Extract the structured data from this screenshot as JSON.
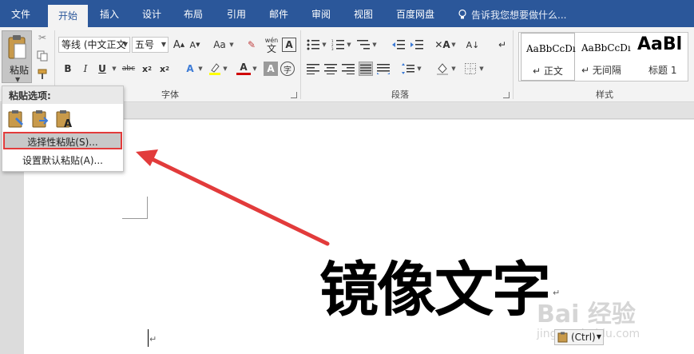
{
  "tabs": [
    {
      "label": "文件",
      "active": false
    },
    {
      "label": "开始",
      "active": true
    },
    {
      "label": "插入",
      "active": false
    },
    {
      "label": "设计",
      "active": false
    },
    {
      "label": "布局",
      "active": false
    },
    {
      "label": "引用",
      "active": false
    },
    {
      "label": "邮件",
      "active": false
    },
    {
      "label": "审阅",
      "active": false
    },
    {
      "label": "视图",
      "active": false
    },
    {
      "label": "百度网盘",
      "active": false
    }
  ],
  "tell_me": "告诉我您想要做什么...",
  "clipboard": {
    "paste_label": "粘贴"
  },
  "font": {
    "group_label": "字体",
    "font_name": "等线 (中文正文",
    "font_size": "五号",
    "wen_glyph": "文",
    "wen_pinyin": "wén",
    "aa_label": "Aa"
  },
  "paragraph": {
    "group_label": "段落"
  },
  "styles": {
    "group_label": "样式",
    "items": [
      {
        "sample": "AaBbCcDı",
        "name": "↵ 正文",
        "selected": true
      },
      {
        "sample": "AaBbCcDı",
        "name": "↵ 无间隔",
        "selected": false
      },
      {
        "sample": "AaBl",
        "name": "标题 1",
        "selected": false
      }
    ]
  },
  "paste_menu": {
    "header": "粘贴选项:",
    "special_paste": "选择性粘贴(S)...",
    "set_default": "设置默认粘贴(A)..."
  },
  "document": {
    "big_text": "镜像文字",
    "paragraph_mark": "↵",
    "ctrl_chip": "(Ctrl)"
  },
  "watermark": {
    "brand": "Bai 经验",
    "url": "jingyan.baidu.com"
  },
  "colors": {
    "tabbar": "#2b579a",
    "annotation": "#e23b3b",
    "highlight_yellow": "#ffff00",
    "font_red": "#d00000"
  }
}
